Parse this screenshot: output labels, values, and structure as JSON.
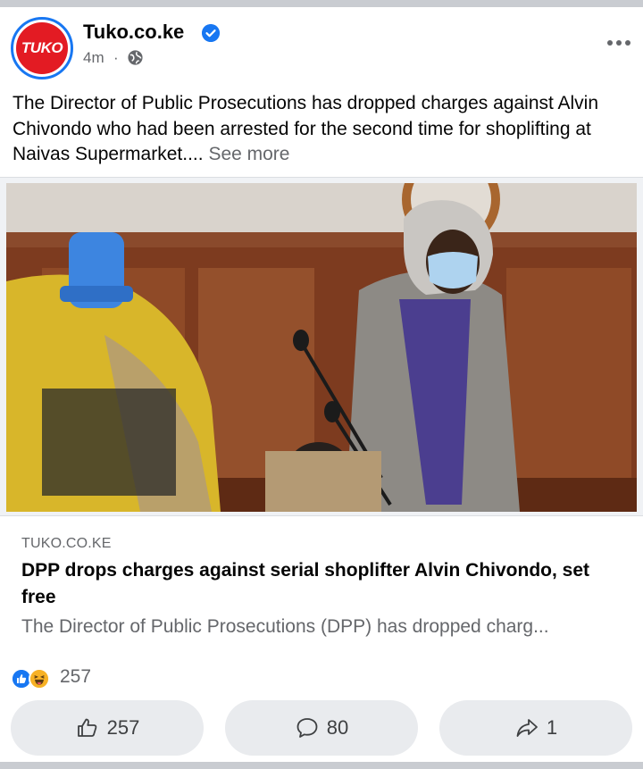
{
  "post": {
    "page_name": "Tuko.co.ke",
    "avatar_text": "TUKO",
    "time": "4m",
    "separator": "·",
    "text": "The Director of Public Prosecutions has dropped charges against Alvin Chivondo who had been arrested for the second time for shoplifting at Naivas Supermarket....",
    "see_more": "See more"
  },
  "link_card": {
    "domain": "TUKO.CO.KE",
    "title": "DPP drops charges against serial shoplifter Alvin Chivondo, set free",
    "description": "The Director of Public Prosecutions (DPP) has dropped charg..."
  },
  "reactions": {
    "count": "257",
    "types": [
      "like-icon",
      "haha-icon"
    ]
  },
  "actions": {
    "like_count": "257",
    "comment_count": "80",
    "share_count": "1"
  },
  "colors": {
    "brand_blue": "#1877f2",
    "tuko_red": "#e31b23",
    "secondary_text": "#65676b",
    "button_bg": "#e9ebee"
  }
}
